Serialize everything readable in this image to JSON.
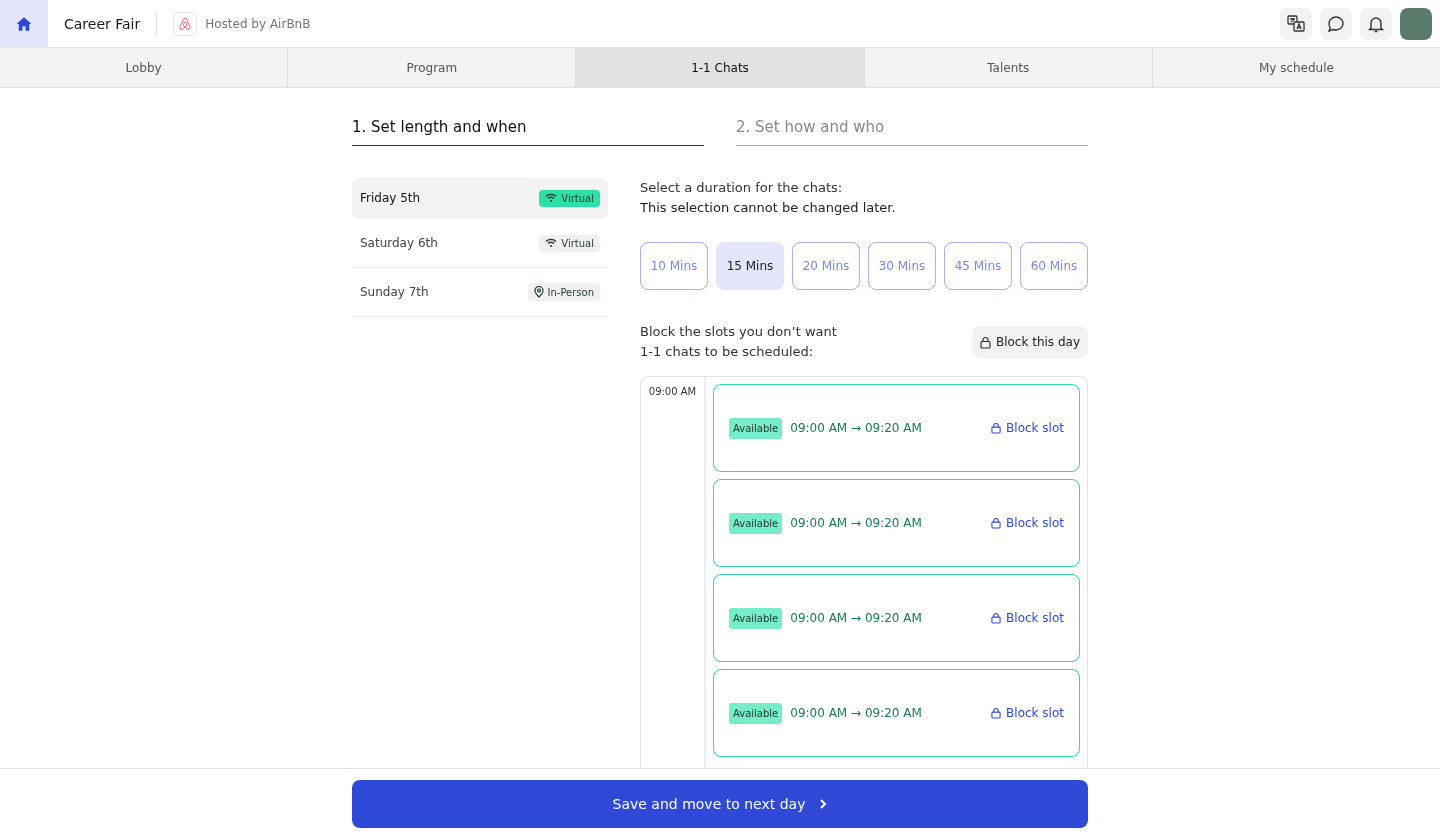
{
  "header": {
    "title": "Career Fair",
    "host": "Hosted by AirBnB"
  },
  "tabs": [
    {
      "label": "Lobby",
      "selected": false
    },
    {
      "label": "Program",
      "selected": false
    },
    {
      "label": "1-1 Chats",
      "selected": true
    },
    {
      "label": "Talents",
      "selected": false
    },
    {
      "label": "My schedule",
      "selected": false
    }
  ],
  "steps": [
    {
      "label": "1. Set length and when",
      "selected": true
    },
    {
      "label": "2. Set how and who",
      "selected": false
    }
  ],
  "days": [
    {
      "label": "Friday 5th",
      "selected": true,
      "kind": "virtual",
      "mode": "Virtual"
    },
    {
      "label": "Saturday 6th",
      "selected": false,
      "kind": "virtual",
      "mode": "Virtual"
    },
    {
      "label": "Sunday 7th",
      "selected": false,
      "kind": "in-person",
      "mode": "In-Person"
    }
  ],
  "duration": {
    "prompt": "Select a duration for the chats:",
    "note": "This selection cannot be changed later.",
    "options": [
      {
        "label": "10 Mins",
        "selected": false
      },
      {
        "label": "15 Mins",
        "selected": true
      },
      {
        "label": "20 Mins",
        "selected": false
      },
      {
        "label": "30 Mins",
        "selected": false
      },
      {
        "label": "45 Mins",
        "selected": false
      },
      {
        "label": "60 Mins",
        "selected": false
      }
    ]
  },
  "block": {
    "text_1": "Block the slots you don’t want",
    "text_2": "1-1 chats to be scheduled:",
    "button": "Block this day"
  },
  "schedule": {
    "hour": "09:00 AM",
    "slots": [
      {
        "status": "Available",
        "time": "09:00 AM → 09:20 AM",
        "action": "Block slot"
      },
      {
        "status": "Available",
        "time": "09:00 AM → 09:20 AM",
        "action": "Block slot"
      },
      {
        "status": "Available",
        "time": "09:00 AM → 09:20 AM",
        "action": "Block slot"
      },
      {
        "status": "Available",
        "time": "09:00 AM → 09:20 AM",
        "action": "Block slot"
      }
    ]
  },
  "footer": {
    "button": "Save and move to next day"
  }
}
